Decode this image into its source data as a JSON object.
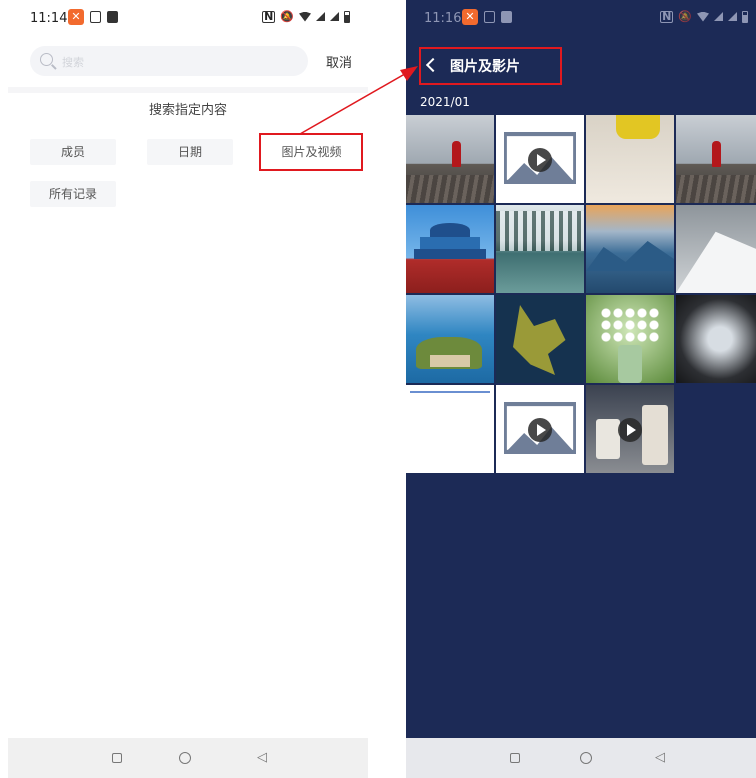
{
  "left_screen": {
    "status": {
      "time": "11:14",
      "badge": "✕"
    },
    "search": {
      "placeholder": "搜索",
      "cancel": "取消"
    },
    "section_title": "搜索指定内容",
    "chips": [
      {
        "label": "成员"
      },
      {
        "label": "日期"
      },
      {
        "label": "图片及视频"
      },
      {
        "label": "所有记录"
      }
    ]
  },
  "right_screen": {
    "status": {
      "time": "11:16",
      "badge": "✕"
    },
    "title": "图片及影片",
    "date_group": "2021/01",
    "media": [
      {
        "kind": "photo",
        "subject": "person-on-pier"
      },
      {
        "kind": "video",
        "subject": "video-placeholder"
      },
      {
        "kind": "photo",
        "subject": "yellow-object"
      },
      {
        "kind": "photo",
        "subject": "person-on-pier"
      },
      {
        "kind": "photo",
        "subject": "temple-of-heaven"
      },
      {
        "kind": "photo",
        "subject": "snowy-lake"
      },
      {
        "kind": "photo",
        "subject": "mountain-valley"
      },
      {
        "kind": "photo",
        "subject": "snowy-ridge"
      },
      {
        "kind": "photo",
        "subject": "island-palace"
      },
      {
        "kind": "photo",
        "subject": "aerial-island"
      },
      {
        "kind": "photo",
        "subject": "white-flowers"
      },
      {
        "kind": "photo",
        "subject": "skyward-view"
      },
      {
        "kind": "photo",
        "subject": "document-screenshot"
      },
      {
        "kind": "video",
        "subject": "video-placeholder"
      },
      {
        "kind": "video",
        "subject": "coffee-cups"
      }
    ]
  },
  "colors": {
    "highlight": "#e0191f",
    "right_background": "#1c2a56",
    "badge": "#f26a2e"
  }
}
